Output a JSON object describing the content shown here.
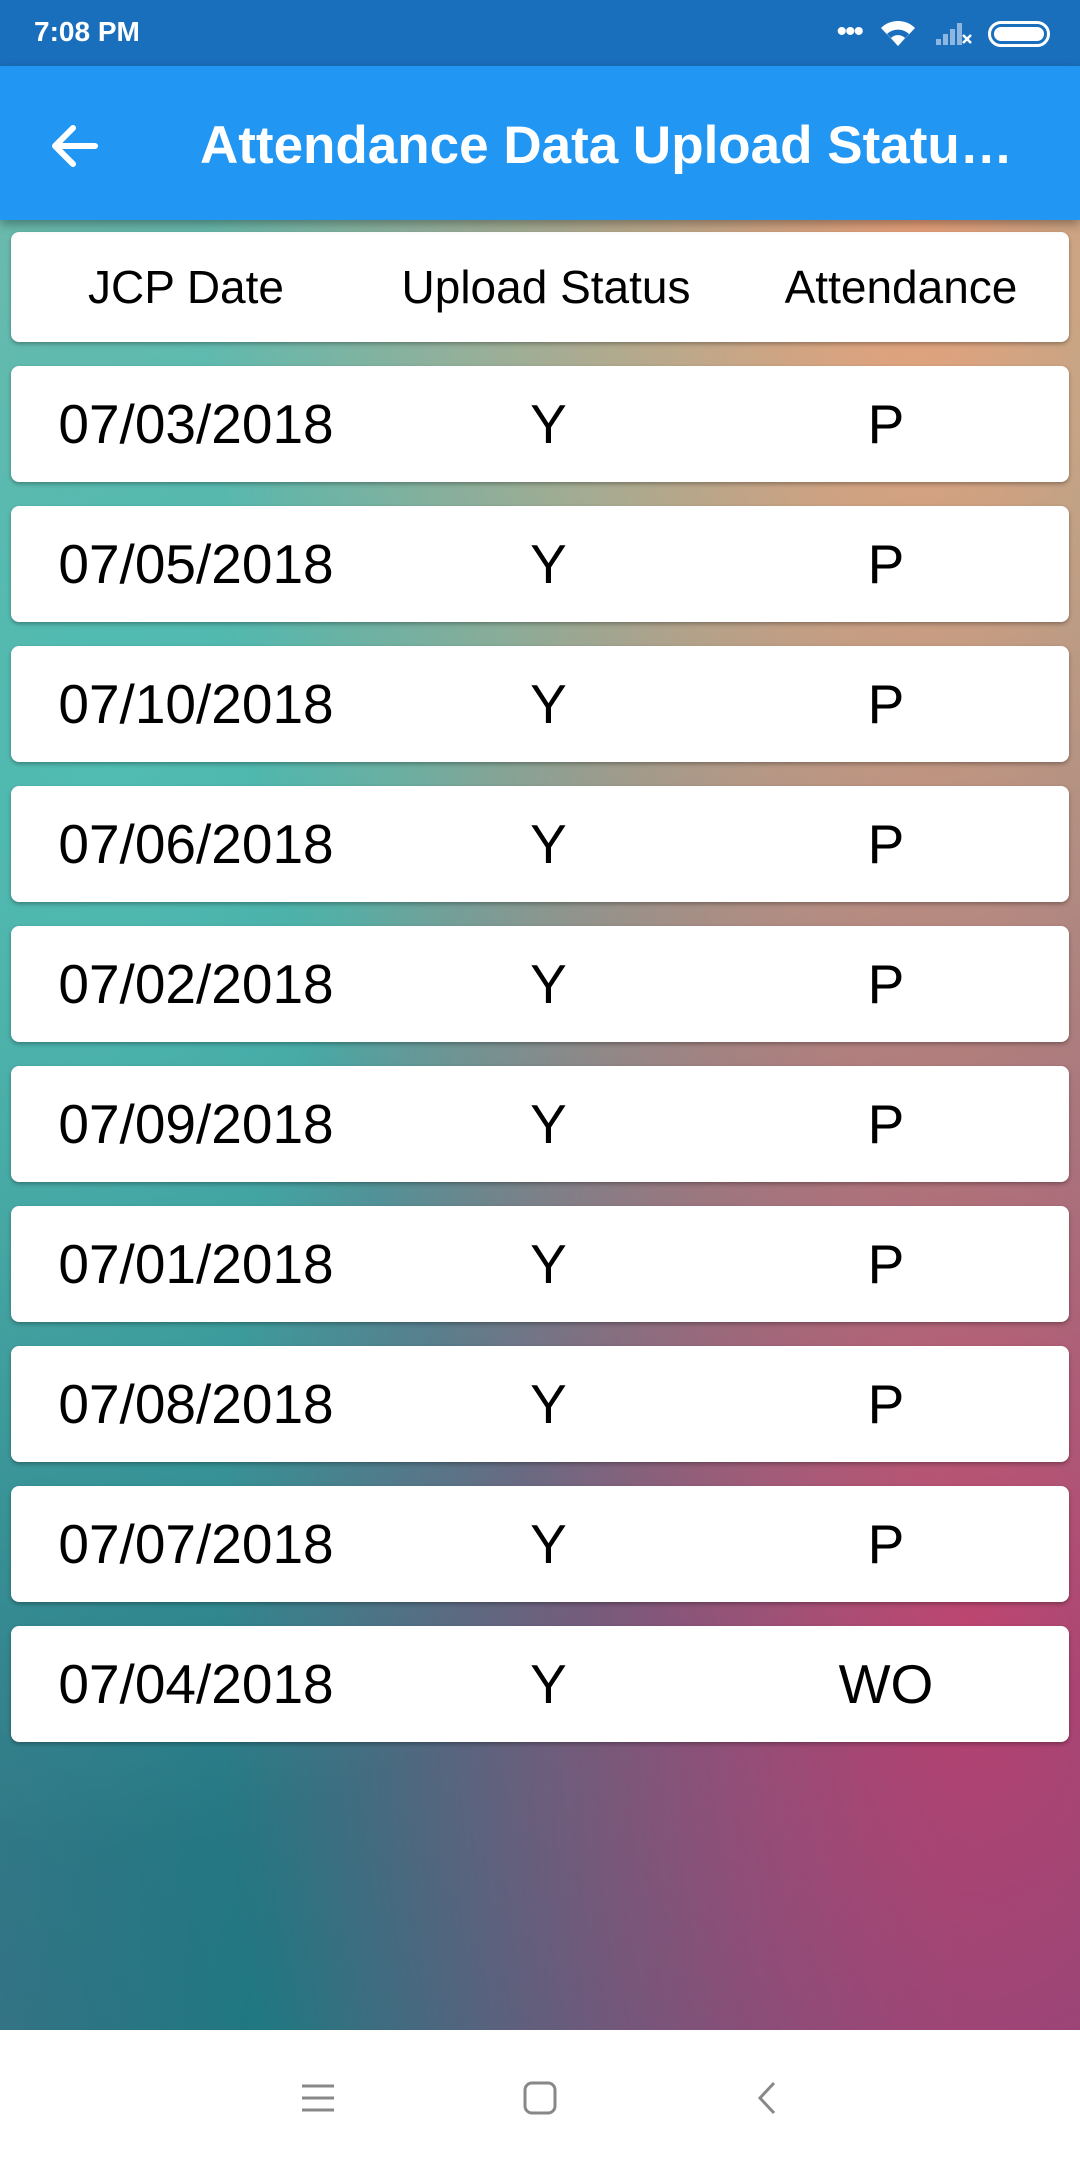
{
  "status_bar": {
    "time": "7:08 PM",
    "dots": "•••",
    "icons": [
      "wifi-icon",
      "signal-icon",
      "battery-icon"
    ]
  },
  "app_bar": {
    "title": "Attendance Data Upload Status ...",
    "back_icon": "arrow-left-icon",
    "background_color": "#2196f3"
  },
  "table": {
    "headers": [
      "JCP Date",
      "Upload Status",
      "Attendance"
    ],
    "rows": [
      {
        "date": "07/03/2018",
        "upload_status": "Y",
        "attendance": "P"
      },
      {
        "date": "07/05/2018",
        "upload_status": "Y",
        "attendance": "P"
      },
      {
        "date": "07/10/2018",
        "upload_status": "Y",
        "attendance": "P"
      },
      {
        "date": "07/06/2018",
        "upload_status": "Y",
        "attendance": "P"
      },
      {
        "date": "07/02/2018",
        "upload_status": "Y",
        "attendance": "P"
      },
      {
        "date": "07/09/2018",
        "upload_status": "Y",
        "attendance": "P"
      },
      {
        "date": "07/01/2018",
        "upload_status": "Y",
        "attendance": "P"
      },
      {
        "date": "07/08/2018",
        "upload_status": "Y",
        "attendance": "P"
      },
      {
        "date": "07/07/2018",
        "upload_status": "Y",
        "attendance": "P"
      },
      {
        "date": "07/04/2018",
        "upload_status": "Y",
        "attendance": "WO"
      }
    ]
  },
  "nav_bar": {
    "icons": [
      "menu-icon",
      "home-square-icon",
      "back-chevron-icon"
    ]
  }
}
